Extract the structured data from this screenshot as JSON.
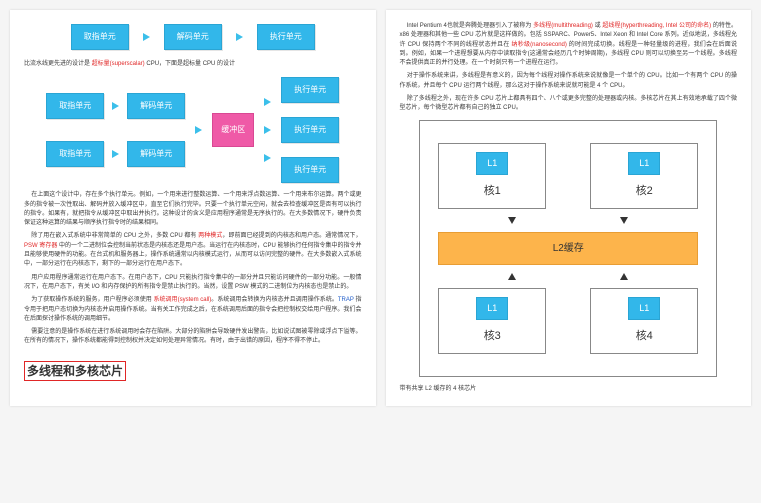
{
  "left": {
    "d1_fetch": "取指单元",
    "d1_decode": "解码单元",
    "d1_exec": "执行单元",
    "line1_a": "比流水线更先进的设计是 ",
    "line1_b": "超标量(superscalar)",
    "line1_c": " CPU，下面是超标量 CPU 的设计",
    "d2_buffer": "缓冲区",
    "p1": "在上面这个设计中，存在多个执行单元。例如，一个用来进行整数运算、一个用来浮点数运算、一个用来布尔运算。两个或更多的指令被一次性取出、解码并放入缓冲区中，直至它们执行完毕。只要一个执行单元空闲，就会去检查缓冲区是否有可以执行的指令。如果有，就把指令从缓冲区中取出并执行。这种设计的含义是应用程序通常是无序执行的。在大多数情况下，硬件负责保证这种运算的结果与顺序执行指令时的结果相同。",
    "p2_a": "除了用在嵌入式系统中非常简单的 CPU 之外，多数 CPU 都有 ",
    "p2_b": "两种模式",
    "p2_c": "，即前面已经提到的内核态和用户态。通常情况下，",
    "p2_d": "PSW 寄存器",
    "p2_e": " 中的一个二进制位会控制当前状态是内核态还是用户态。当运行在内核态时，CPU 能够执行任何指令集中的指令并且能够使用硬件的功能。在台式机和服务器上，操作系统通常以内核模式运行，从而可以访问完整的硬件。在大多数嵌入式系统中，一部分运行在内核态下，剩下的一部分运行在用户态下。",
    "p3": "用户应用程序通常运行在用户态下。在用户态下，CPU 只能执行指令集中的一部分并且只能访问硬件的一部分功能。一般情况下，在用户态下，有关 I/O 和内存保护的所有指令是禁止执行的。当然，设置 PSW 模式的二进制位为内核态也是禁止的。",
    "p4_a": "为了获取操作系统的服务，用户程序必须使用 ",
    "p4_b": "系统调用(system call)",
    "p4_c": "。系统调用会转换为内核态并且调用操作系统。",
    "p4_d": "TRAP",
    "p4_e": " 指令用于把用户态切换为内核态并启用操作系统。当有关工作完成之后，在系统调用后面的指令会把控制权交给用户程序。我们会在后面探讨操作系统的调用细节。",
    "p5": "需要注意的是操作系统在进行系统调用时会存在陷阱。大部分的陷阱会导致硬件发出警告，比如说试图被零除或浮点下溢等。在所有的情况下，操作系统都能得到控制权并决定如何处理异常情况。有时，由于出错的原因，程序不得不停止。",
    "h2": "多线程和多核芯片"
  },
  "right": {
    "p1_a": "Intel Pentium 4也就是奔腾处理器引入了被称为 ",
    "p1_b": "多线程(multithreading)",
    "p1_c": " 或 ",
    "p1_d": "超线程(hyperthreading, Intel 公司的命名)",
    "p1_e": " 的特性。x86 处理器和其他一些 CPU 芯片就是这样做的。包括 SSPARC、Power5、Intel Xeon 和 Intel Core 系列。近似地说，多线程允许 CPU 保持两个不同的线程状态并且在 ",
    "p1_f": "纳秒级(nanosecond)",
    "p1_g": " 的时间完成切换。线程是一种轻量级的进程，我们会在后面说到。例如，如果一个进程想要从内存中读取指令(这通常会经历几个时钟周期)，多线程 CPU 则可以切换至另一个线程。多线程不会提供真正的并行处理。在一个时刻只有一个进程在运行。",
    "p2": "对于操作系统来讲，多线程是有意义的，因为每个线程对操作系统来说就像是一个单个的 CPU。比如一个有两个 CPU 的操作系统，并且每个 CPU 运行两个线程，那么这对于操作系统来说就可能是 4 个 CPU。",
    "p3": "除了多线程之外，现在许多 CPU 芯片上都具有四个、八个或更多完整的处理器或内核。多核芯片在其上有效地承载了四个微型芯片，每个微型芯片都有自己的独立 CPU。",
    "l1": "L1",
    "core1": "核1",
    "core2": "核2",
    "core3": "核3",
    "core4": "核4",
    "l2": "L2缓存",
    "caption": "带有共享 L2 缓存的 4 核芯片"
  }
}
